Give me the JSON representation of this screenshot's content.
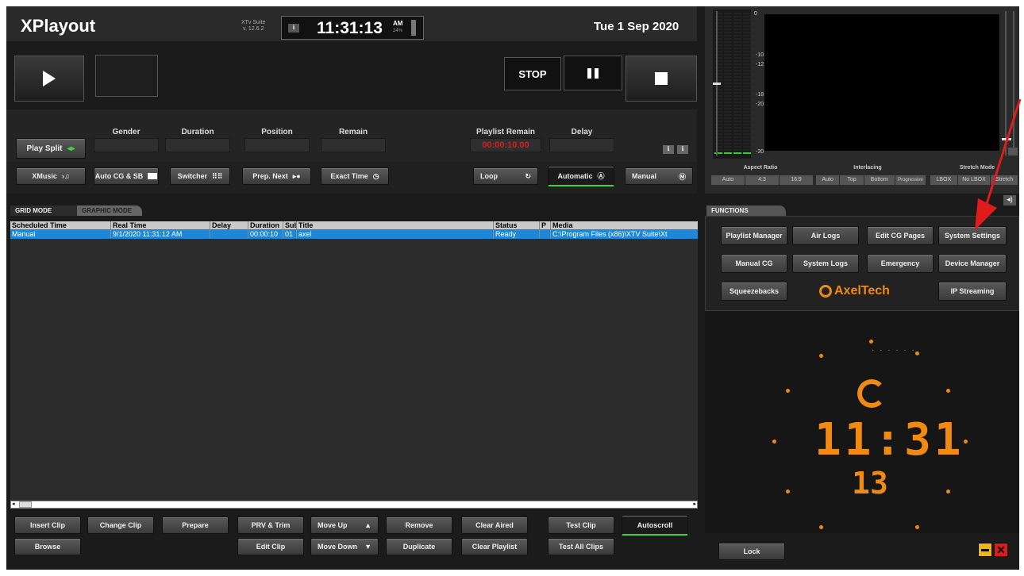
{
  "header": {
    "app_title": "XPlayout",
    "suite_name": "XTv Suite",
    "version": "v. 12.6.2",
    "clock_time": "11:31:13",
    "clock_ampm": "AM",
    "clock_pct": "24%",
    "date": "Tue 1 Sep 2020"
  },
  "transport": {
    "stop_label": "STOP"
  },
  "info": {
    "play_split_label": "Play Split",
    "gender_label": "Gender",
    "duration_label": "Duration",
    "position_label": "Position",
    "remain_label": "Remain",
    "playlist_remain_label": "Playlist Remain",
    "playlist_remain_value": "00:00:10.00",
    "delay_label": "Delay"
  },
  "toolbar": {
    "xmusic": "XMusic",
    "auto_cg": "Auto CG & SB",
    "switcher": "Switcher",
    "prep_next": "Prep. Next",
    "exact_time": "Exact Time",
    "loop": "Loop",
    "automatic": "Automatic",
    "manual": "Manual"
  },
  "tabs": {
    "grid_mode": "GRID MODE",
    "graphic_mode": "GRAPHIC MODE",
    "functions": "FUNCTIONS"
  },
  "playlist": {
    "columns": [
      "Scheduled Time",
      "Real Time",
      "Delay",
      "Duration",
      "Sub",
      "Title",
      "Status",
      "P",
      "Media"
    ],
    "rows": [
      [
        "Manual",
        "9/1/2020  11:31:12 AM",
        "",
        "00:00:10",
        "01",
        "axel",
        "Ready",
        "",
        "C:\\Program Files (x86)\\XTV Suite\\Xt"
      ]
    ]
  },
  "bottom": {
    "insert_clip": "Insert Clip",
    "change_clip": "Change Clip",
    "prepare": "Prepare",
    "prv_trim": "PRV & Trim",
    "move_up": "Move Up",
    "remove": "Remove",
    "clear_aired": "Clear Aired",
    "test_clip": "Test Clip",
    "autoscroll": "Autoscroll",
    "browse": "Browse",
    "edit_clip": "Edit Clip",
    "move_down": "Move Down",
    "duplicate": "Duplicate",
    "clear_playlist": "Clear Playlist",
    "test_all_clips": "Test All Clips"
  },
  "monitor": {
    "meter_scale": [
      "0",
      "-10",
      "-12",
      "-18",
      "-20",
      "-30"
    ],
    "aspect_ratio_label": "Aspect Ratio",
    "aspect_options": [
      "Auto",
      "4:3",
      "16:9"
    ],
    "interlacing_label": "Interlacing",
    "interlacing_options": [
      "Auto",
      "Top",
      "Bottom",
      "Progressive"
    ],
    "stretch_label": "Stretch Mode",
    "stretch_options": [
      "LBOX",
      "No LBOX",
      "Stretch"
    ]
  },
  "functions": {
    "playlist_manager": "Playlist Manager",
    "air_logs": "Air Logs",
    "edit_cg_pages": "Edit CG Pages",
    "system_settings": "System Settings",
    "manual_cg": "Manual CG",
    "system_logs": "System Logs",
    "emergency": "Emergency",
    "device_manager": "Device Manager",
    "squeezebacks": "Squeezebacks",
    "brand_logo": "AxelTech",
    "ip_streaming": "IP Streaming"
  },
  "big_clock": {
    "hm": "11:31",
    "sec": "13"
  },
  "footer": {
    "lock": "Lock"
  },
  "colors": {
    "accent_orange": "#f08a12",
    "selection_blue": "#1e88d8",
    "meter_green": "#2dd22d",
    "alert_red": "#e01b1b"
  }
}
